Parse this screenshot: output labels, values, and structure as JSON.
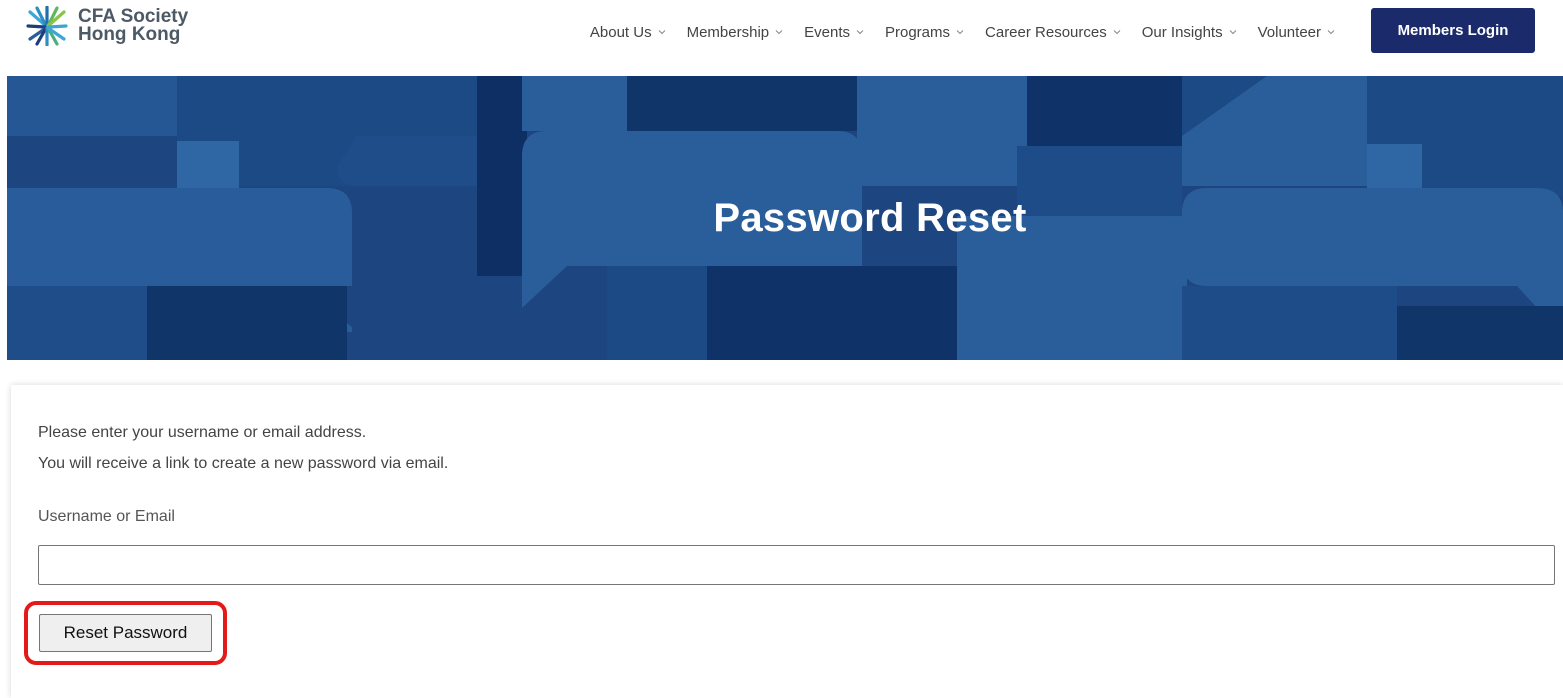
{
  "header": {
    "logo_line1": "CFA Society",
    "logo_line2": "Hong Kong",
    "nav": [
      {
        "label": "About Us"
      },
      {
        "label": "Membership"
      },
      {
        "label": "Events"
      },
      {
        "label": "Programs"
      },
      {
        "label": "Career Resources"
      },
      {
        "label": "Our Insights"
      },
      {
        "label": "Volunteer"
      }
    ],
    "login_label": "Members Login"
  },
  "hero": {
    "title": "Password Reset"
  },
  "form": {
    "intro_line1": "Please enter your username or email address.",
    "intro_line2": "You will receive a link to create a new password via email.",
    "field_label": "Username or Email",
    "field_value": "",
    "submit_label": "Reset Password"
  },
  "colors": {
    "brand_navy": "#1a2a6b",
    "hero_blue": "#1d4580",
    "highlight_red": "#e41a1a"
  },
  "icons": {
    "logo": "cfa-logo-icon",
    "dropdown": "chevron-down-icon"
  }
}
